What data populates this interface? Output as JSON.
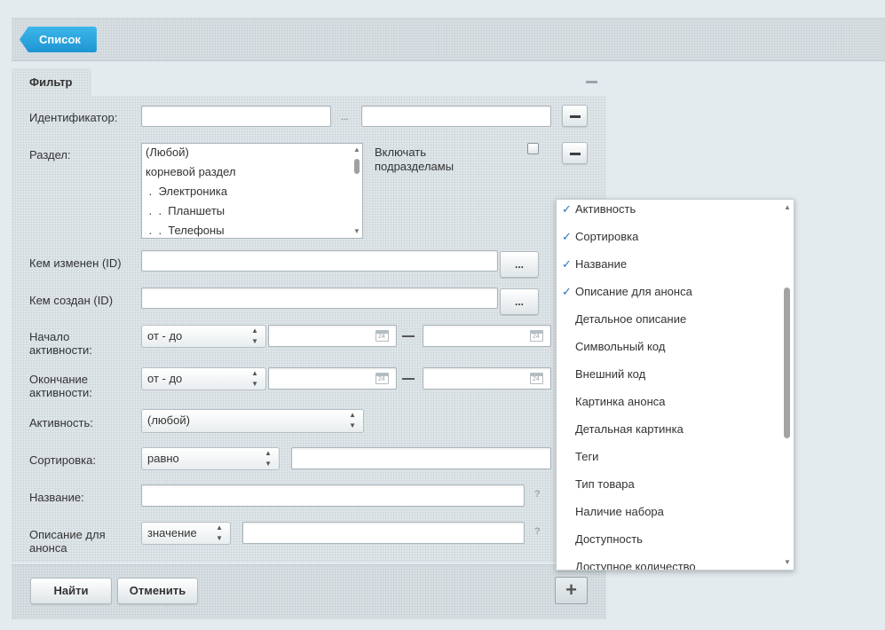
{
  "toolbar": {
    "back_label": "Список"
  },
  "filter": {
    "tab_label": "Фильтр",
    "id_label": "Идентификатор:",
    "range_dots": "...",
    "section_label": "Раздел:",
    "section_options": [
      "(Любой)",
      "корневой раздел",
      " .  Электроника",
      " .  .  Планшеты",
      " .  .  Телефоны"
    ],
    "include_sub_label_1": "Включать",
    "include_sub_label_2": "подразделамы",
    "modified_by_label": "Кем изменен (ID)",
    "created_by_label": "Кем создан (ID)",
    "dots_button": "...",
    "active_from_label_1": "Начало",
    "active_from_label_2": "активности:",
    "active_to_label_1": "Окончание",
    "active_to_label_2": "активности:",
    "range_select": "от - до",
    "calendar_day": "24",
    "active_label": "Активность:",
    "active_select": "(любой)",
    "sort_label": "Сортировка:",
    "sort_select": "равно",
    "name_label": "Название:",
    "preview_label_1": "Описание для",
    "preview_label_2": "анонса",
    "preview_select": "значение",
    "help": "?"
  },
  "footer": {
    "find_label": "Найти",
    "cancel_label": "Отменить",
    "add_label": "+"
  },
  "fields_popup": {
    "items": [
      {
        "label": "Активность",
        "checked": true
      },
      {
        "label": "Сортировка",
        "checked": true
      },
      {
        "label": "Название",
        "checked": true
      },
      {
        "label": "Описание для анонса",
        "checked": true
      },
      {
        "label": "Детальное описание",
        "checked": false
      },
      {
        "label": "Символьный код",
        "checked": false
      },
      {
        "label": "Внешний код",
        "checked": false
      },
      {
        "label": "Картинка анонса",
        "checked": false
      },
      {
        "label": "Детальная картинка",
        "checked": false
      },
      {
        "label": "Теги",
        "checked": false
      },
      {
        "label": "Тип товара",
        "checked": false
      },
      {
        "label": "Наличие набора",
        "checked": false
      },
      {
        "label": "Доступность",
        "checked": false
      },
      {
        "label": "Доступное количество",
        "checked": false
      }
    ],
    "check_glyph": "✓"
  },
  "colors": {
    "accent": "#2a9fdc",
    "check": "#2d6fb5",
    "panel": "#dfe6e9"
  }
}
